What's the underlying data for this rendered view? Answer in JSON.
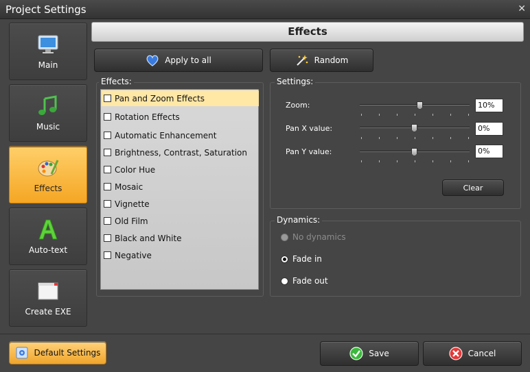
{
  "window": {
    "title": "Project Settings",
    "close_glyph": "✕"
  },
  "sidebar": {
    "items": [
      {
        "label": "Main",
        "icon": "monitor-icon"
      },
      {
        "label": "Music",
        "icon": "music-note-icon"
      },
      {
        "label": "Effects",
        "icon": "palette-icon",
        "active": true
      },
      {
        "label": "Auto-text",
        "icon": "letter-a-icon"
      },
      {
        "label": "Create EXE",
        "icon": "window-icon"
      }
    ]
  },
  "header": {
    "title": "Effects"
  },
  "toolbar": {
    "apply_label": "Apply to all",
    "random_label": "Random"
  },
  "effects": {
    "legend": "Effects:",
    "items": [
      {
        "label": "Pan and Zoom Effects",
        "selected": true
      },
      {
        "label": "Rotation Effects"
      },
      {
        "label": "Automatic Enhancement"
      },
      {
        "label": "Brightness, Contrast, Saturation"
      },
      {
        "label": "Color Hue"
      },
      {
        "label": "Mosaic"
      },
      {
        "label": "Vignette"
      },
      {
        "label": "Old Film"
      },
      {
        "label": "Black and White"
      },
      {
        "label": "Negative"
      }
    ]
  },
  "settings": {
    "legend": "Settings:",
    "sliders": [
      {
        "label": "Zoom:",
        "value": "10%",
        "level": 0.55
      },
      {
        "label": "Pan X value:",
        "value": "0%",
        "level": 0.5
      },
      {
        "label": "Pan Y value:",
        "value": "0%",
        "level": 0.5
      }
    ],
    "clear_label": "Clear"
  },
  "dynamics": {
    "legend": "Dynamics:",
    "options": [
      {
        "label": "No dynamics",
        "disabled": true
      },
      {
        "label": "Fade in",
        "checked": true
      },
      {
        "label": "Fade out"
      }
    ]
  },
  "footer": {
    "default_label": "Default Settings",
    "save_label": "Save",
    "cancel_label": "Cancel"
  },
  "colors": {
    "accent": "#f5a623",
    "panel": "#454545",
    "list_bg": "#d0d0d0",
    "selected_row": "#ffe7a6"
  }
}
